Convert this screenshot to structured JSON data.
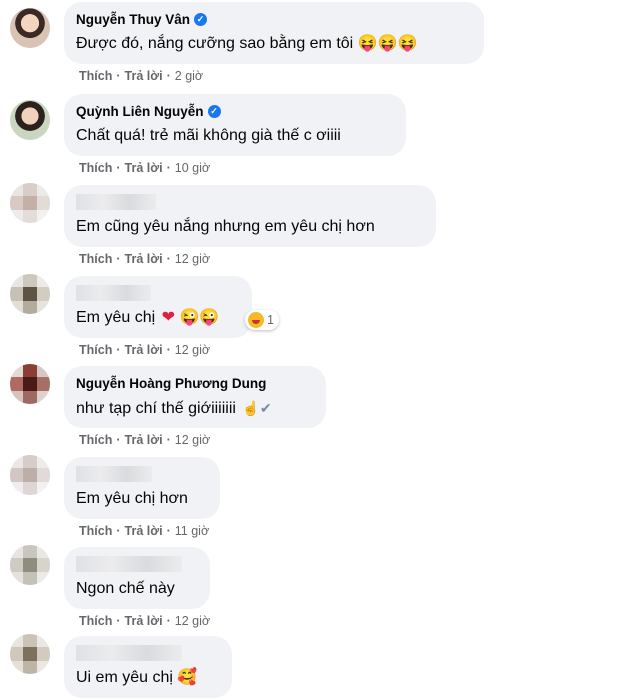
{
  "comments": [
    {
      "name": "Nguyễn Thuy Vân",
      "verified": true,
      "text": "Được đó, nắng cưỡng sao bằng em tôi",
      "emoji": "😝😝😝",
      "like": "Thích",
      "reply": "Trả lời",
      "time": "2 giờ"
    },
    {
      "name": "Quỳnh Liên Nguyễn",
      "verified": true,
      "text": "Chất quá! trẻ mãi không già thế c ơiiii",
      "like": "Thích",
      "reply": "Trả lời",
      "time": "10 giờ"
    },
    {
      "text": "Em cũng yêu nắng nhưng em yêu chị hơn",
      "like": "Thích",
      "reply": "Trả lời",
      "time": "12 giờ"
    },
    {
      "text": "Em yêu chị",
      "emoji": "😜😜",
      "reaction_count": "1",
      "like": "Thích",
      "reply": "Trả lời",
      "time": "12 giờ"
    },
    {
      "name": "Nguyễn Hoàng Phương Dung",
      "text": "như tạp chí thế giớiiiiiii",
      "like": "Thích",
      "reply": "Trả lời",
      "time": "12 giờ"
    },
    {
      "text": "Em yêu chị hơn",
      "like": "Thích",
      "reply": "Trả lời",
      "time": "11 giờ"
    },
    {
      "text": "Ngon chế này",
      "like": "Thích",
      "reply": "Trả lời",
      "time": "12 giờ"
    },
    {
      "text": "Ui em yêu chị",
      "emoji": "🥰"
    }
  ],
  "colors": {
    "bubble": "#f0f2f5",
    "meta_text": "#65676b",
    "verified": "#1877f2"
  }
}
